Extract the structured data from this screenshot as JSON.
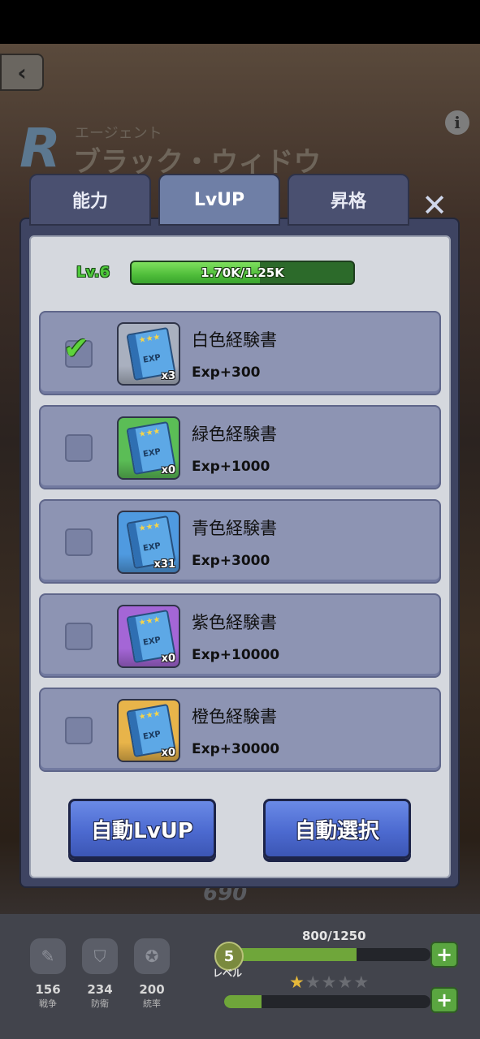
{
  "header": {
    "back_icon": "chevron-left-icon",
    "rank": "R",
    "agent_subtitle": "エージェント",
    "agent_name": "ブラック・ウィドウ",
    "info_icon": "info-icon"
  },
  "tabs": [
    {
      "label": "能力",
      "active": false
    },
    {
      "label": "LvUP",
      "active": true
    },
    {
      "label": "昇格",
      "active": false
    }
  ],
  "close_icon": "close-icon",
  "level": {
    "label": "Lv.6",
    "exp_text": "1.70K/1.25K",
    "progress": 0.58
  },
  "items": [
    {
      "name": "白色経験書",
      "exp": "Exp+300",
      "count": "x3",
      "checked": true,
      "color": "#a9b0bf"
    },
    {
      "name": "緑色経験書",
      "exp": "Exp+1000",
      "count": "x0",
      "checked": false,
      "color": "#5bbd56"
    },
    {
      "name": "青色経験書",
      "exp": "Exp+3000",
      "count": "x31",
      "checked": false,
      "color": "#4f9ae0"
    },
    {
      "name": "紫色経験書",
      "exp": "Exp+10000",
      "count": "x0",
      "checked": false,
      "color": "#a466d6"
    },
    {
      "name": "橙色経験書",
      "exp": "Exp+30000",
      "count": "x0",
      "checked": false,
      "color": "#e8b44a"
    }
  ],
  "buttons": {
    "auto_lvup": "自動LvUP",
    "auto_select": "自動選択"
  },
  "hud": {
    "power": "690",
    "stats": [
      {
        "value": "156",
        "label": "戦争",
        "icon": "pencil-icon"
      },
      {
        "value": "234",
        "label": "防衛",
        "icon": "shield-icon"
      },
      {
        "value": "200",
        "label": "統率",
        "icon": "star-badge-icon"
      }
    ],
    "exp_text": "800/1250",
    "level_value": "5",
    "level_label": "レベル",
    "exp_progress": 0.64,
    "star_rating": 1,
    "star_max": 5,
    "star_progress": 0.18
  }
}
